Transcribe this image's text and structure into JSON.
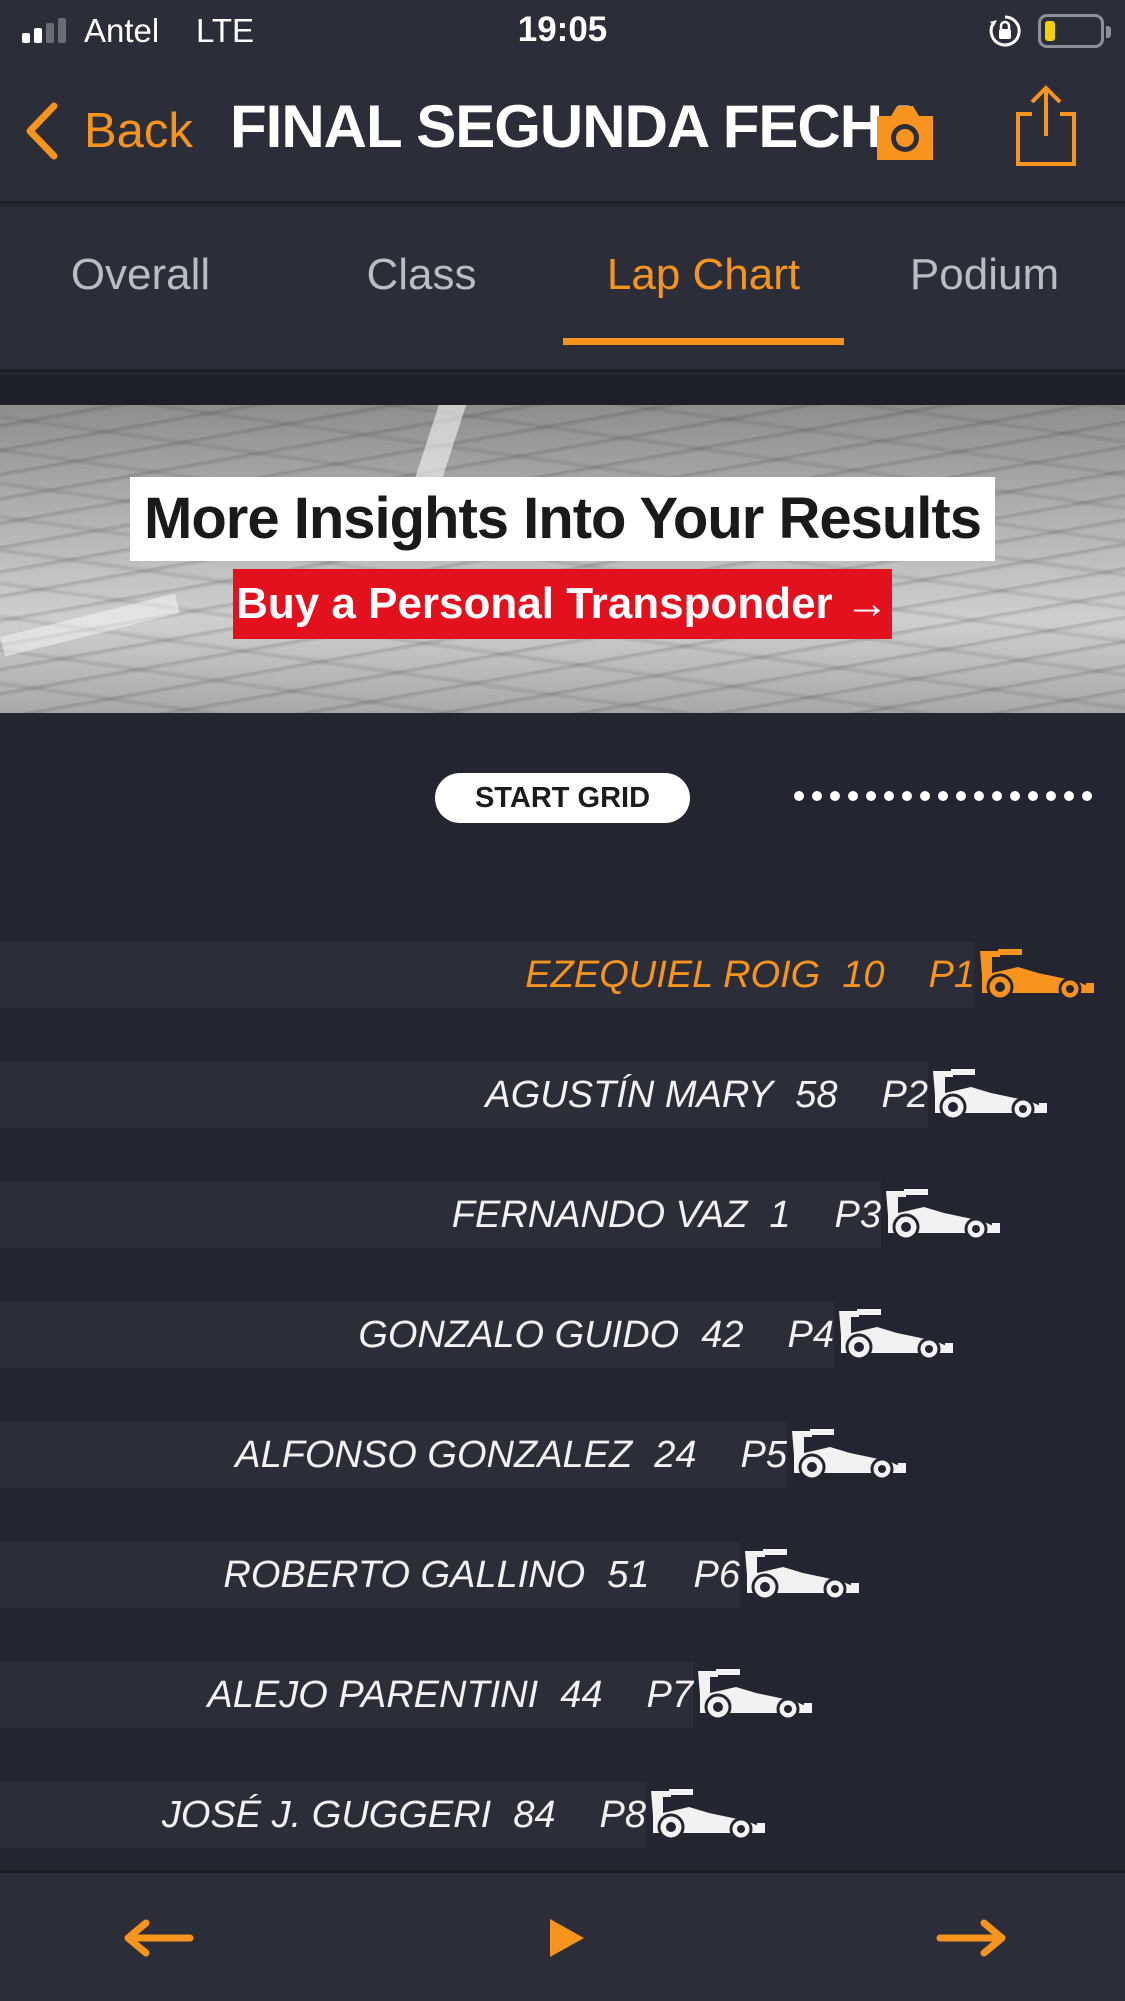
{
  "status_bar": {
    "carrier": "Antel",
    "network": "LTE",
    "time": "19:05"
  },
  "navbar": {
    "back_label": "Back",
    "title": "FINAL SEGUNDA FECHA"
  },
  "tabs": [
    {
      "label": "Overall",
      "active": false
    },
    {
      "label": "Class",
      "active": false
    },
    {
      "label": "Lap Chart",
      "active": true
    },
    {
      "label": "Podium",
      "active": false
    }
  ],
  "banner": {
    "headline": "More Insights Into Your Results",
    "cta": "Buy a Personal Transponder →"
  },
  "lap_chart": {
    "start_label": "START GRID",
    "drivers": [
      {
        "name": "EZEQUIEL ROIG",
        "number": "10",
        "position": "P1",
        "leader": true
      },
      {
        "name": "AGUSTÍN MARY",
        "number": "58",
        "position": "P2",
        "leader": false
      },
      {
        "name": "FERNANDO VAZ",
        "number": "1",
        "position": "P3",
        "leader": false
      },
      {
        "name": "GONZALO GUIDO",
        "number": "42",
        "position": "P4",
        "leader": false
      },
      {
        "name": "ALFONSO GONZALEZ",
        "number": "24",
        "position": "P5",
        "leader": false
      },
      {
        "name": "ROBERTO GALLINO",
        "number": "51",
        "position": "P6",
        "leader": false
      },
      {
        "name": "ALEJO PARENTINI",
        "number": "44",
        "position": "P7",
        "leader": false
      },
      {
        "name": "JOSÉ J. GUGGERI",
        "number": "84",
        "position": "P8",
        "leader": false
      }
    ]
  },
  "controls": {
    "prev_icon": "arrow-left-icon",
    "play_icon": "play-icon",
    "next_icon": "arrow-right-icon"
  },
  "colors": {
    "accent": "#f7941d",
    "background": "#242731",
    "bar": "#2b2e38",
    "cta_red": "#e3101d"
  }
}
